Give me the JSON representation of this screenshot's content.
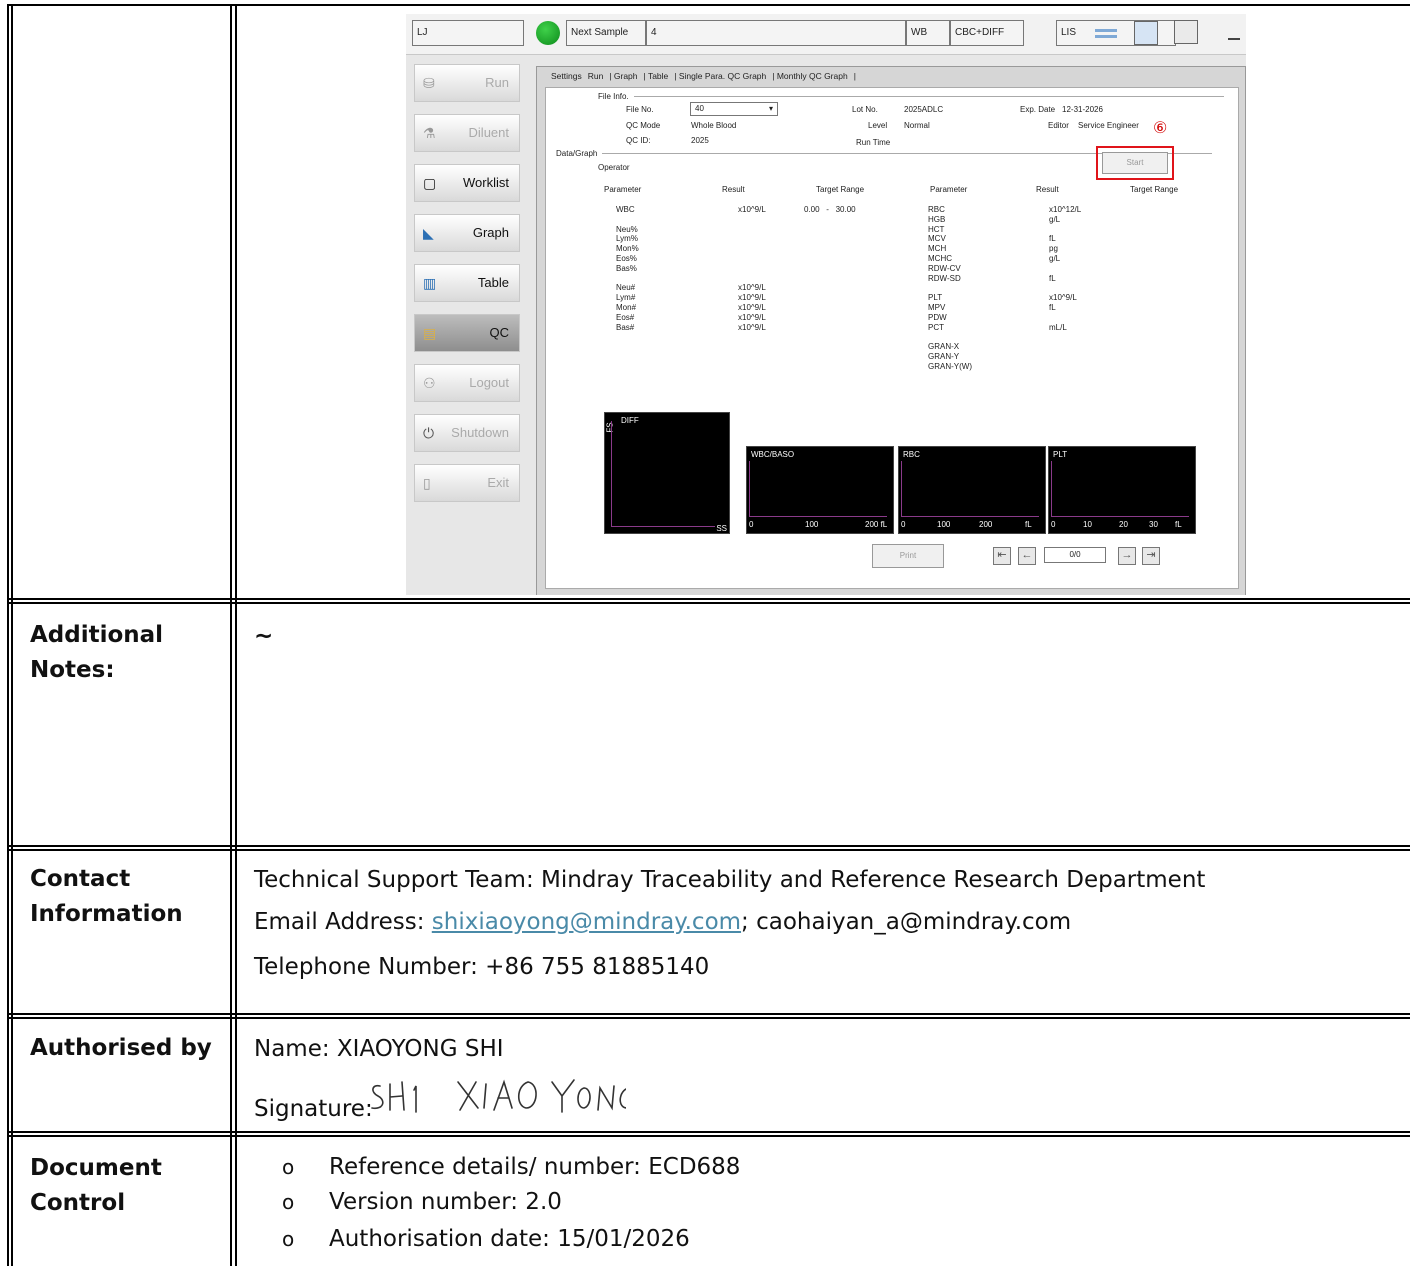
{
  "screenshot": {
    "top_bar": {
      "user": "LJ",
      "next_sample_label": "Next Sample",
      "next_sample_value": "4",
      "mode": "WB",
      "test": "CBC+DIFF",
      "lis": "LIS"
    },
    "nav": [
      "Run",
      "Diluent",
      "Worklist",
      "Graph",
      "Table",
      "QC",
      "Logout",
      "Shutdown",
      "Exit"
    ],
    "tabs": [
      "Settings",
      "Run",
      "Graph",
      "Table",
      "Single Para. QC Graph",
      "Monthly QC Graph"
    ],
    "file_info": {
      "section": "File Info.",
      "file_no_label": "File No.",
      "file_no": "40",
      "lot_no_label": "Lot No.",
      "lot_no": "2025ADLC",
      "exp_date_label": "Exp. Date",
      "exp_date": "12-31-2026",
      "qc_mode_label": "QC Mode",
      "qc_mode": "Whole Blood",
      "level_label": "Level",
      "level": "Normal",
      "editor_label": "Editor",
      "editor": "Service Engineer",
      "qc_id_label": "QC ID:",
      "qc_id": "2025",
      "run_time_label": "Run Time"
    },
    "data_graph": {
      "section": "Data/Graph",
      "operator_label": "Operator",
      "start": "Start",
      "marker": "⑥",
      "headers": [
        "Parameter",
        "Result",
        "Target Range",
        "Parameter",
        "Result",
        "Target Range"
      ],
      "left_params": "WBC\n\nNeu%\nLym%\nMon%\nEos%\nBas%\n\nNeu#\nLym#\nMon#\nEos#\nBas#",
      "left_units": "x10^9/L\n\n\n\n\n\n\n\nx10^9/L\nx10^9/L\nx10^9/L\nx10^9/L\nx10^9/L",
      "wbc_range": "0.00   -   30.00",
      "right_params": "RBC\nHGB\nHCT\nMCV\nMCH\nMCHC\nRDW-CV\nRDW-SD\n\nPLT\nMPV\nPDW\nPCT\n\nGRAN-X\nGRAN-Y\nGRAN-Y(W)",
      "right_units": "x10^12/L\ng/L\n\nfL\npg\ng/L\n\nfL\n\nx10^9/L\nfL\n\nmL/L"
    },
    "graphs": {
      "diff": "DIFF",
      "fs": "FS",
      "ss": "SS",
      "wbc": "WBC/BASO",
      "wbc_ticks": [
        "0",
        "100",
        "200 fL"
      ],
      "rbc": "RBC",
      "rbc_ticks": [
        "0",
        "100",
        "200",
        "fL"
      ],
      "plt": "PLT",
      "plt_ticks": [
        "0",
        "10",
        "20",
        "30",
        "fL"
      ]
    },
    "print": "Print",
    "pager": "0/0"
  },
  "rows": {
    "notes_label": "Additional Notes:",
    "notes_value": "~",
    "contact_label": "Contact Information",
    "contact_team": "Technical Support Team: Mindray Traceability and Reference Research Department",
    "contact_email_prefix": "Email Address: ",
    "contact_email1": "shixiaoyong@mindray.com",
    "contact_email_rest": "; caohaiyan_a@mindray.com",
    "contact_phone": "Telephone Number: +86 755 81885140",
    "auth_label": "Authorised by",
    "auth_name": "Name: XIAOYONG SHI",
    "auth_signature_label": "Signature: ",
    "auth_signature": "SHI XIAO YONG",
    "doc_label": "Document Control",
    "doc_items": [
      "Reference details/ number: ECD688",
      "Version number: 2.0",
      "Authorisation date: 15/01/2026"
    ],
    "bullet": "o"
  }
}
